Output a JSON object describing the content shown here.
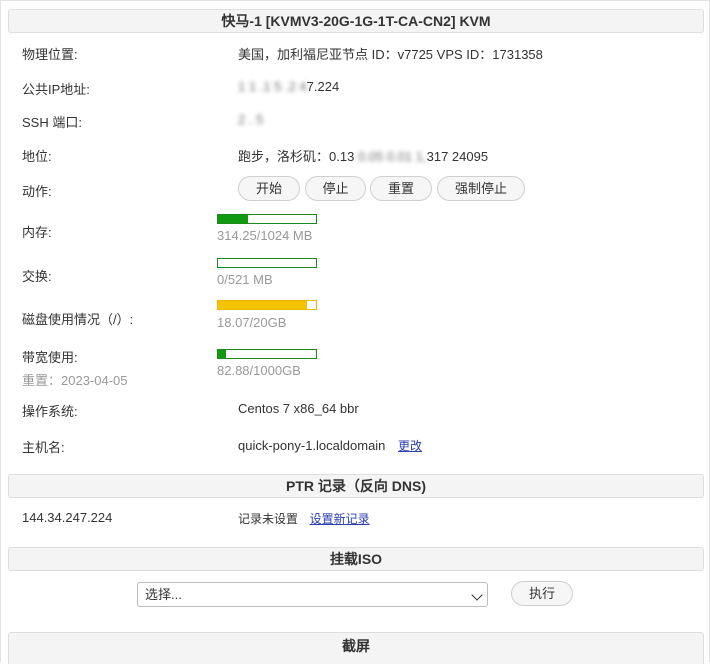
{
  "panel": {
    "title": "快马-1 [KVMV3-20G-1G-1T-CA-CN2] KVM"
  },
  "info": {
    "location_label": "物理位置:",
    "location_value": "美国，加利福尼亚节点 ID：v7725 VPS ID：1731358",
    "public_ip_label": "公共IP地址:",
    "public_ip_blurred_prefix": "1 1 .1 5 .2 4",
    "public_ip_value": "7.224",
    "ssh_label": "SSH 端口:",
    "ssh_value_blurred": "2 .  5",
    "status_label": "地位:",
    "status_value": "跑步，洛杉矶：0.13",
    "status_blurred": "0.05 0.01 1,",
    "status_tail": "317 24095",
    "actions_label": "动作:",
    "memory_label": "内存:",
    "memory_value": "314.25/1024 MB",
    "memory_fraction": 0.307,
    "swap_label": "交换:",
    "swap_value": "0/521 MB",
    "swap_fraction": 0.0,
    "disk_label": "磁盘使用情况（/）:",
    "disk_value": "18.07/20GB",
    "disk_fraction": 0.9035,
    "bandwidth_label": "带宽使用:",
    "bandwidth_reset": "重置：2023-04-05",
    "bandwidth_value": "82.88/1000GB",
    "bandwidth_fraction": 0.083,
    "os_label": "操作系统:",
    "os_value": "Centos 7 x86_64 bbr",
    "hostname_label": "主机名:",
    "hostname_value": "quick-pony-1.localdomain",
    "hostname_change": "更改"
  },
  "actions": {
    "start": "开始",
    "stop": "停止",
    "reset": "重置",
    "force_stop": "强制停止"
  },
  "ptr": {
    "title": "PTR 记录（反向 DNS)",
    "ip": "144.34.247.224",
    "status": "记录未设置",
    "set_link": "设置新记录"
  },
  "iso": {
    "title": "挂载ISO",
    "select_value": "选择...",
    "execute": "执行"
  },
  "screenshot": {
    "title": "截屏"
  },
  "colors": {
    "bar_green": "#119911",
    "bar_yellow": "#f5c400",
    "link_blue": "#2a3fb0"
  }
}
